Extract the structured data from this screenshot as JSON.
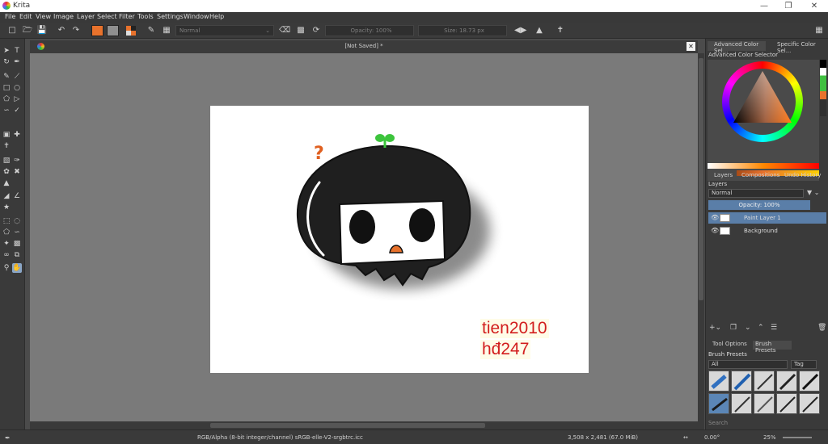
{
  "app": {
    "title": "Krita"
  },
  "menu": [
    "File",
    "Edit",
    "View",
    "Image",
    "Layer",
    "Select",
    "Filter",
    "Tools",
    "Settings",
    "Window",
    "Help"
  ],
  "toolbar": {
    "blend_mode": "Normal",
    "opacity": "Opacity: 100%",
    "size": "Size: 18.73 px",
    "fg_color": "#e8722c",
    "bg_color": "#8f8f8f"
  },
  "document": {
    "tab_title": "[Not Saved]  *",
    "watermark_line1": "tien2010",
    "watermark_line2": "hđ247"
  },
  "dock": {
    "color_tabs": [
      "Advanced Color Sel...",
      "Specific Color Sel..."
    ],
    "color_selector_title": "Advanced Color Selector",
    "layer_tabs": [
      "Layers",
      "Compositions",
      "Undo History"
    ],
    "layers_title": "Layers",
    "layer_blend_mode": "Normal",
    "layer_opacity": "Opacity:  100%",
    "layers": [
      {
        "name": "Paint Layer 1",
        "selected": true
      },
      {
        "name": "Background",
        "selected": false
      }
    ],
    "bottom_tabs": [
      "Tool Options",
      "Brush Presets"
    ],
    "presets_title": "Brush Presets",
    "presets_filter": "All",
    "presets_tag": "Tag",
    "search_placeholder": "Search"
  },
  "status": {
    "color_space": "RGB/Alpha (8-bit integer/channel)  sRGB-elle-V2-srgbtrc.icc",
    "dimensions": "3,508 x 2,481 (67.0 MiB)",
    "rotation": "0.00°",
    "zoom": "25%"
  },
  "colors": {
    "accent": "#5a7ea8",
    "watermark": "#d21e1e",
    "sprout": "#3cc43c",
    "question_mark": "#e06020"
  }
}
